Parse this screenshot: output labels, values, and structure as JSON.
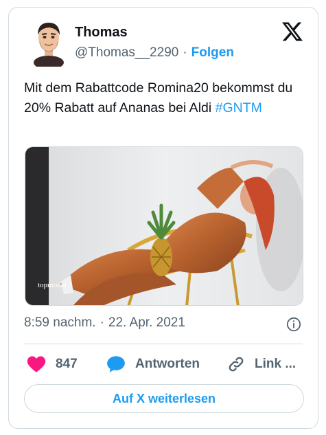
{
  "author": {
    "name": "Thomas",
    "handle": "@Thomas__2290",
    "separator": "·",
    "follow_label": "Folgen"
  },
  "tweet": {
    "text_before": "Mit dem Rabattcode  Romina20 bekommst du 20% Rabatt auf Ananas bei Aldi  ",
    "hashtag": "#GNTM",
    "media_watermark": "topmodel"
  },
  "meta": {
    "time": "8:59 nachm.",
    "separator": "·",
    "date": "22. Apr. 2021"
  },
  "actions": {
    "like_count": "847",
    "reply_label": "Antworten",
    "link_label": "Link ..."
  },
  "read_more_label": "Auf X weiterlesen",
  "colors": {
    "accent": "#1d9bf0",
    "like": "#f91880",
    "muted": "#536471",
    "border": "#cfd9de"
  },
  "icons": [
    "x-logo-icon",
    "info-icon",
    "heart-icon",
    "reply-bubble-icon",
    "link-icon"
  ]
}
